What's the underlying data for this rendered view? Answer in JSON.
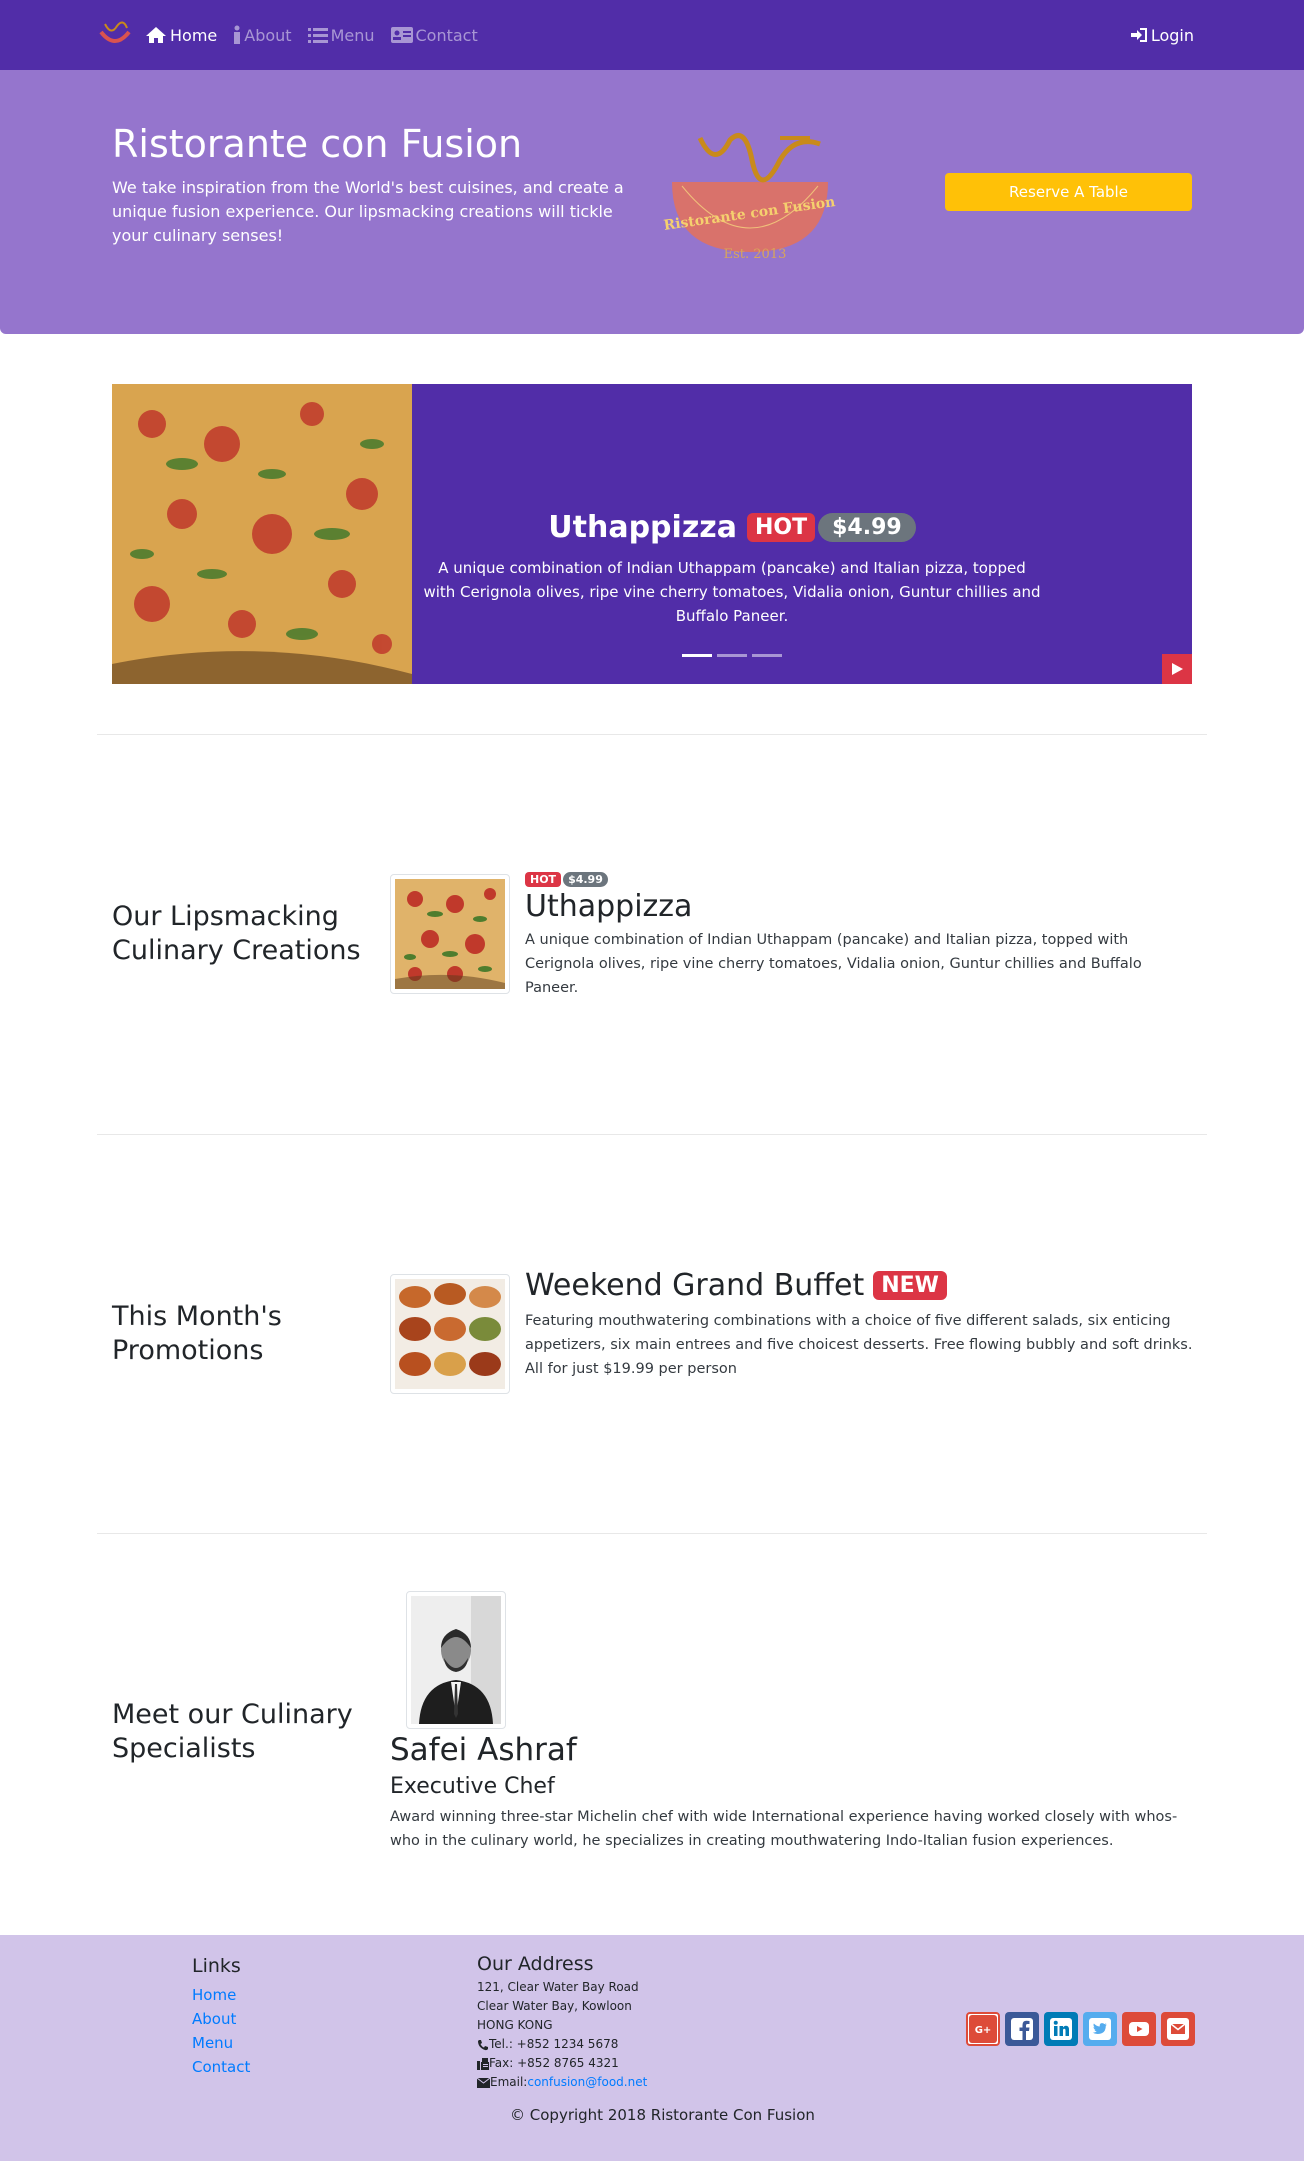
{
  "nav": {
    "items": [
      {
        "label": "Home",
        "icon": "home-icon",
        "active": true
      },
      {
        "label": "About",
        "icon": "info-icon",
        "active": false
      },
      {
        "label": "Menu",
        "icon": "list-icon",
        "active": false
      },
      {
        "label": "Contact",
        "icon": "address-card-icon",
        "active": false
      }
    ],
    "login_label": "Login"
  },
  "jumbotron": {
    "title": "Ristorante con Fusion",
    "text": "We take inspiration from the World's best cuisines, and create a unique fusion experience. Our lipsmacking creations will tickle your culinary senses!",
    "reserve_label": "Reserve A Table",
    "logo_text": "Ristorante con Fusion",
    "logo_est": "Est. 2013"
  },
  "carousel": {
    "title": "Uthappizza",
    "badge_hot": "HOT",
    "price": "$4.99",
    "text": "A unique combination of Indian Uthappam (pancake) and Italian pizza, topped with Cerignola olives, ripe vine cherry tomatoes, Vidalia onion, Guntur chillies and Buffalo Paneer.",
    "slides": 3,
    "active_slide": 1
  },
  "dish": {
    "section_title": "Our Lipsmacking Culinary Creations",
    "badge_hot": "HOT",
    "price": "$4.99",
    "title": "Uthappizza",
    "text": "A unique combination of Indian Uthappam (pancake) and Italian pizza, topped with Cerignola olives, ripe vine cherry tomatoes, Vidalia onion, Guntur chillies and Buffalo Paneer."
  },
  "promotion": {
    "section_title": "This Month's Promotions",
    "title": "Weekend Grand Buffet",
    "badge_new": "NEW",
    "text": "Featuring mouthwatering combinations with a choice of five different salads, six enticing appetizers, six main entrees and five choicest desserts. Free flowing bubbly and soft drinks. All for just $19.99 per person"
  },
  "leader": {
    "section_title": "Meet our Culinary Specialists",
    "name": "Safei Ashraf",
    "designation": "Executive Chef",
    "text": "Award winning three-star Michelin chef with wide International experience having worked closely with whos-who in the culinary world, he specializes in creating mouthwatering Indo-Italian fusion experiences."
  },
  "footer": {
    "links_title": "Links",
    "links": [
      "Home",
      "About",
      "Menu",
      "Contact"
    ],
    "address_title": "Our Address",
    "address_lines": [
      "121, Clear Water Bay Road",
      "Clear Water Bay, Kowloon",
      "HONG KONG"
    ],
    "tel": "Tel.: +852 1234 5678",
    "fax": "Fax: +852 8765 4321",
    "email_label": "Email: ",
    "email": "confusion@food.net",
    "social": [
      {
        "name": "google-plus-icon",
        "color": "#dd4b39"
      },
      {
        "name": "facebook-icon",
        "color": "#3b5998"
      },
      {
        "name": "linkedin-icon",
        "color": "#007bb6"
      },
      {
        "name": "twitter-icon",
        "color": "#55acee"
      },
      {
        "name": "youtube-icon",
        "color": "#dd4b39"
      },
      {
        "name": "mail-icon",
        "color": "#dd4b39"
      }
    ],
    "copyright": "© Copyright 2018 Ristorante Con Fusion"
  },
  "colors": {
    "primary": "#512da8",
    "jumbotron": "#9575cd",
    "footer": "#d1c4e9",
    "warning": "#ffc107",
    "danger": "#dc3545"
  }
}
